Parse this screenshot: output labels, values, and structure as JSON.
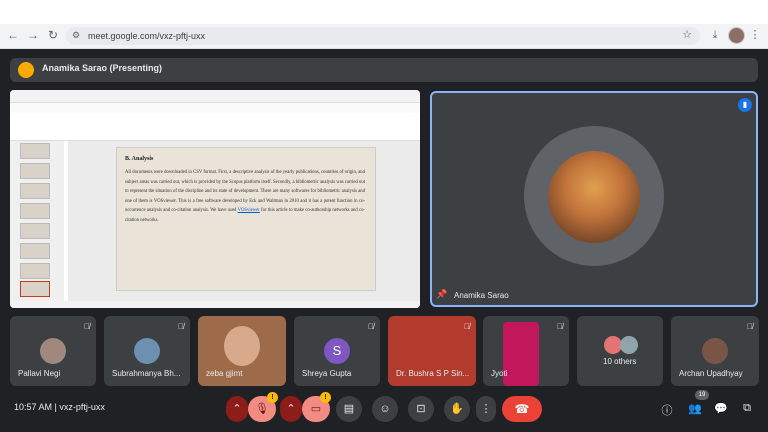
{
  "browser": {
    "url": "meet.google.com/vxz-pftj-uxx"
  },
  "banner": {
    "text": "Anamika Sarao (Presenting)"
  },
  "slide": {
    "heading": "B. Analysis",
    "body_part1": "All documents were downloaded in CSV format. First, a descriptive analysis of the yearly publications, countries of origin, and subject areas was carried out, which is provided by the Scopus platform itself. Secondly, a bibliometric analysis was carried out to represent the situation of the discipline and its state of development. There are many softwares for bibliometric analysis and one of them is VOSviewer. This is a free software developed by Eck and Waltman in 2010 and it has a potent function in co-occurrence analysis and co-citation analysis. We have used ",
    "body_link": "VOSviewer",
    "body_part2": " for this article to make co-authorship networks and co-citation networks."
  },
  "main_tile": {
    "name": "Anamika Sarao"
  },
  "participants": [
    {
      "name": "Pallavi Negi"
    },
    {
      "name": "Subrahmanya Bh..."
    },
    {
      "name": "zeba gjimt"
    },
    {
      "name": "Shreya Gupta",
      "initial": "S"
    },
    {
      "name": "Dr. Bushra S P Sin..."
    },
    {
      "name": "Jyoti"
    },
    {
      "name": "10 others"
    },
    {
      "name": "Archan Upadhyay"
    }
  ],
  "footer": {
    "time": "10:57 AM",
    "separator": "|",
    "meeting_code": "vxz-pftj-uxx",
    "people_count": "19",
    "warn_badge": "!"
  },
  "colors": {
    "accent": "#8ab4f8",
    "end_call": "#ea4335",
    "mic_off": "#f28b82"
  }
}
